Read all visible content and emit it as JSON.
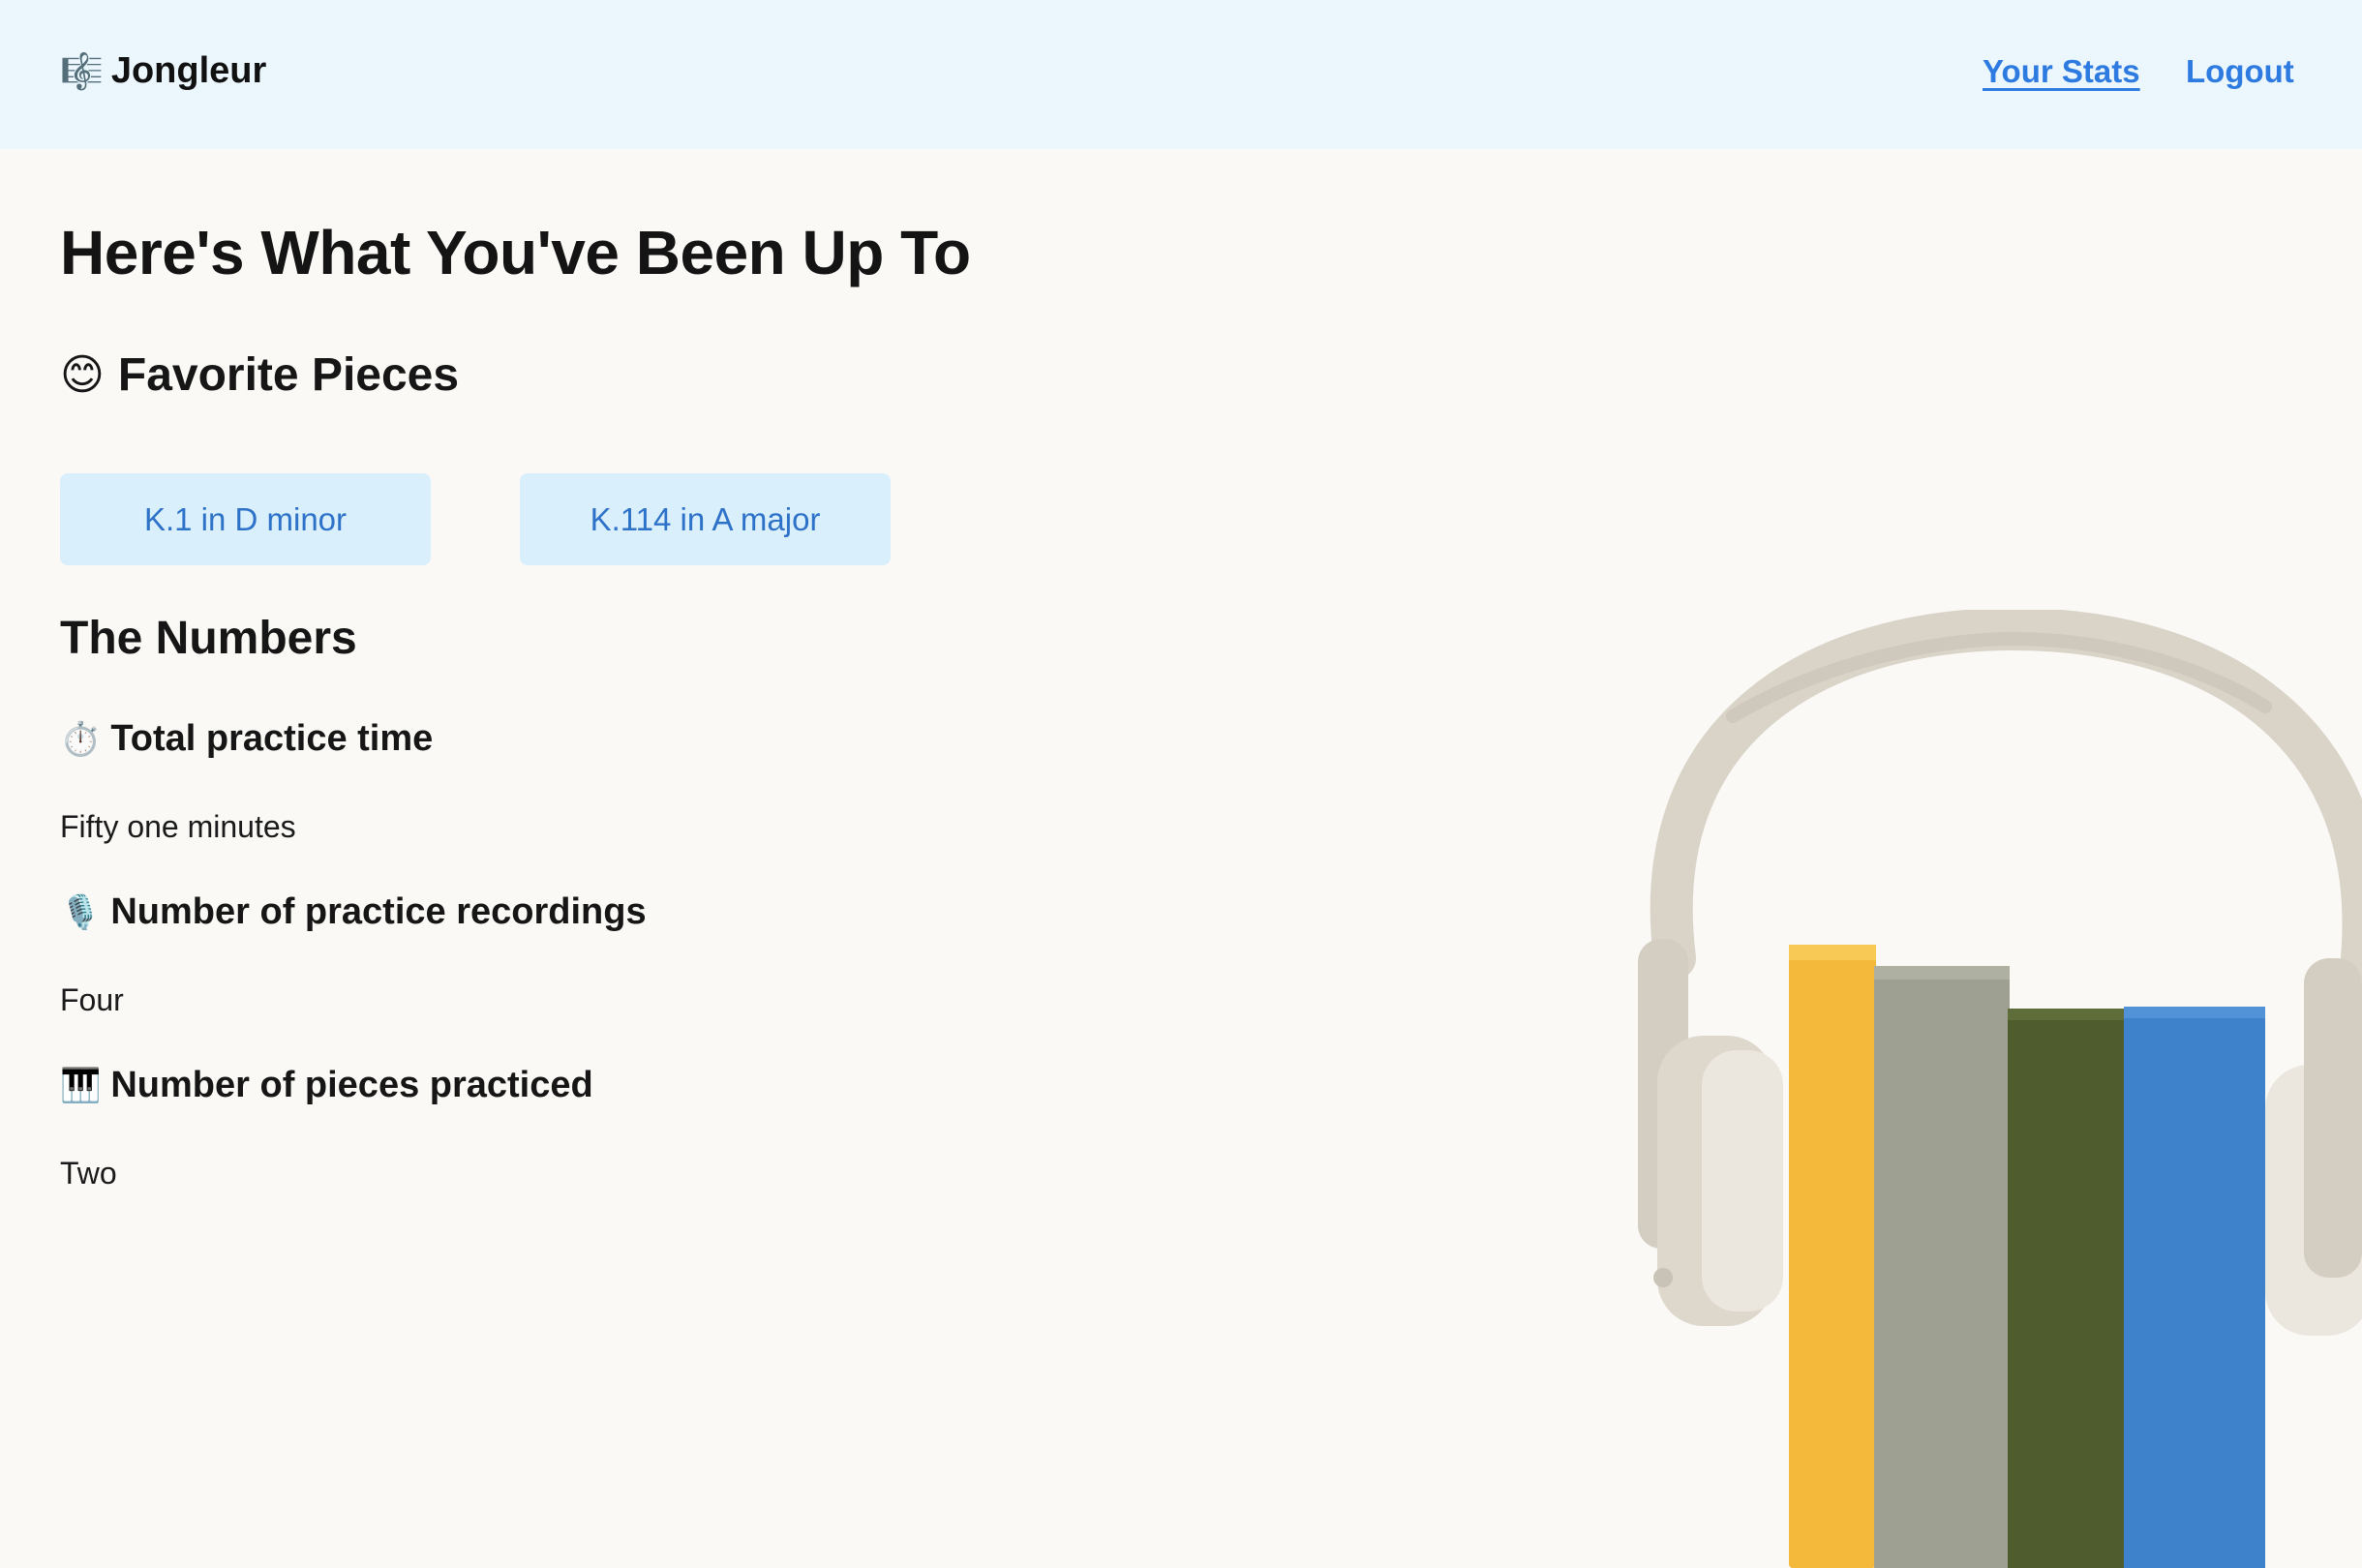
{
  "header": {
    "brand_icon": "music-staff-icon",
    "brand_icon_glyph": "🎼",
    "brand_name": "Jongleur",
    "nav": {
      "stats_label": "Your Stats",
      "logout_label": "Logout"
    }
  },
  "main": {
    "title": "Here's What You've Been Up To",
    "favorites": {
      "icon": "smile-emoji-icon",
      "icon_glyph": "😊",
      "heading": "Favorite Pieces",
      "pieces": [
        {
          "label": "K.1 in D minor"
        },
        {
          "label": "K.114 in A major"
        }
      ]
    },
    "numbers": {
      "heading": "The Numbers",
      "stats": [
        {
          "icon": "stopwatch-icon",
          "icon_glyph": "⏱️",
          "label": "Total practice time",
          "value": "Fifty one minutes"
        },
        {
          "icon": "microphone-icon",
          "icon_glyph": "🎙️",
          "label": "Number of practice recordings",
          "value": "Four"
        },
        {
          "icon": "piano-keys-icon",
          "icon_glyph": "🎹",
          "label": "Number of pieces practiced",
          "value": "Two"
        }
      ]
    }
  },
  "colors": {
    "header_bg": "#ebf6fd",
    "page_bg": "#faf9f5",
    "link": "#2d7ae0",
    "piece_button_bg": "#d9effc",
    "book_yellow": "#f4b93a",
    "book_gray": "#9ea091",
    "book_green": "#4f5d2e",
    "book_blue": "#3f82cc",
    "headphones": "#d9d3c8"
  }
}
